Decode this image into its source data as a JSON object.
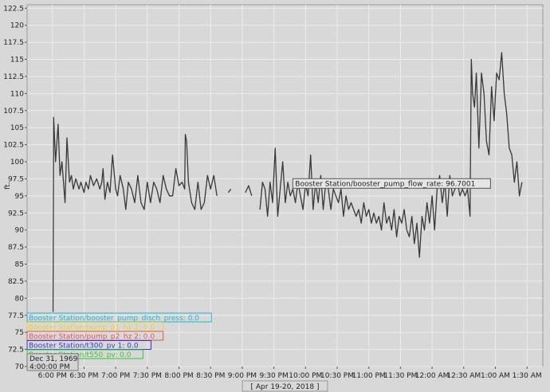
{
  "chart_data": {
    "type": "line",
    "ylabel": "ft.",
    "xlabel": "[ Apr 19-20, 2018 ]",
    "ylim": [
      70,
      123
    ],
    "xlim_hours": [
      17.6,
      25.75
    ],
    "grid": true,
    "background": "#d8d8d8",
    "y_ticks": [
      "70",
      "72.5",
      "75",
      "77.5",
      "80",
      "82.5",
      "85",
      "87.5",
      "90",
      "92.5",
      "95",
      "97.5",
      "100",
      "102.5",
      "105",
      "107.5",
      "110",
      "112.5",
      "115",
      "117.5",
      "120",
      "122.5"
    ],
    "x_ticks": [
      {
        "label": "6:00 PM",
        "h": 18.0
      },
      {
        "label": "6:30 PM",
        "h": 18.5
      },
      {
        "label": "7:00 PM",
        "h": 19.0
      },
      {
        "label": "7:30 PM",
        "h": 19.5
      },
      {
        "label": "8:00 PM",
        "h": 20.0
      },
      {
        "label": "8:30 PM",
        "h": 20.5
      },
      {
        "label": "9:00 PM",
        "h": 21.0
      },
      {
        "label": "9:30 PM",
        "h": 21.5
      },
      {
        "label": "10:00 PM",
        "h": 22.0
      },
      {
        "label": "10:30 PM",
        "h": 22.5
      },
      {
        "label": "11:00 PM",
        "h": 23.0
      },
      {
        "label": "11:30 PM",
        "h": 23.5
      },
      {
        "label": "12:00 AM",
        "h": 24.0
      },
      {
        "label": "12:30 AM",
        "h": 24.5
      },
      {
        "label": "1:00 AM",
        "h": 25.0
      },
      {
        "label": "1:30 AM",
        "h": 25.5
      }
    ],
    "tooltip": {
      "text": "Booster Station/booster_pump_flow_rate: 96.7001",
      "h": 22.0,
      "y": 96.7
    },
    "legend": [
      {
        "text": "Booster Station/booster_pump_disch_press: 0.0",
        "color": "#22b8c8"
      },
      {
        "text": "Booster Station/pump_p1_hz 2: 0.0",
        "color": "#e8d040"
      },
      {
        "text": "Booster Station/pump_p2_hz 2: 0.0",
        "color": "#e05858"
      },
      {
        "text": "Booster Station/t300_pv 1: 0.0",
        "color": "#3838d8"
      },
      {
        "text": "Booster Station/t550_pv: 0.0",
        "color": "#38c838"
      }
    ],
    "cursor_label": {
      "date": "Dec 31, 1969",
      "time": "4:00:00 PM"
    },
    "series": [
      {
        "name": "Booster Station/booster_pump_flow_rate",
        "color": "#383838",
        "segments": [
          [
            [
              18.01,
              78
            ],
            [
              18.02,
              106.5
            ],
            [
              18.05,
              100
            ],
            [
              18.09,
              105.5
            ],
            [
              18.12,
              98
            ],
            [
              18.15,
              100
            ],
            [
              18.2,
              94
            ],
            [
              18.23,
              103.5
            ],
            [
              18.27,
              97
            ],
            [
              18.3,
              98
            ],
            [
              18.33,
              96
            ],
            [
              18.37,
              97.5
            ],
            [
              18.42,
              96
            ],
            [
              18.45,
              97
            ],
            [
              18.5,
              95.5
            ],
            [
              18.53,
              97
            ],
            [
              18.57,
              96
            ],
            [
              18.6,
              98
            ],
            [
              18.65,
              96.5
            ],
            [
              18.7,
              97.5
            ],
            [
              18.75,
              96
            ],
            [
              18.78,
              97
            ],
            [
              18.8,
              99
            ],
            [
              18.83,
              94.5
            ],
            [
              18.87,
              97
            ],
            [
              18.91,
              95.5
            ],
            [
              18.95,
              101
            ],
            [
              19.0,
              96
            ],
            [
              19.03,
              95
            ],
            [
              19.07,
              98
            ],
            [
              19.12,
              96
            ],
            [
              19.16,
              93
            ],
            [
              19.2,
              97
            ],
            [
              19.25,
              96
            ],
            [
              19.3,
              94
            ],
            [
              19.35,
              98
            ],
            [
              19.4,
              94
            ],
            [
              19.45,
              93
            ],
            [
              19.5,
              97
            ],
            [
              19.55,
              94
            ],
            [
              19.6,
              97
            ],
            [
              19.65,
              96
            ],
            [
              19.7,
              94
            ],
            [
              19.75,
              98
            ],
            [
              19.8,
              96
            ],
            [
              19.85,
              95
            ],
            [
              19.9,
              95
            ],
            [
              19.95,
              99
            ],
            [
              20.0,
              96.5
            ],
            [
              20.05,
              97
            ],
            [
              20.09,
              96
            ],
            [
              20.1,
              104
            ],
            [
              20.12,
              103
            ],
            [
              20.15,
              97
            ],
            [
              20.2,
              94
            ],
            [
              20.25,
              93
            ],
            [
              20.3,
              97
            ],
            [
              20.35,
              93
            ],
            [
              20.4,
              94
            ],
            [
              20.45,
              98
            ],
            [
              20.5,
              96
            ],
            [
              20.55,
              98
            ],
            [
              20.6,
              95
            ]
          ],
          [
            [
              20.78,
              95.5
            ],
            [
              20.82,
              96
            ]
          ],
          [
            [
              21.05,
              95.5
            ],
            [
              21.1,
              96.5
            ],
            [
              21.15,
              95
            ]
          ],
          [
            [
              21.28,
              93
            ],
            [
              21.32,
              97
            ],
            [
              21.36,
              96
            ],
            [
              21.4,
              92
            ],
            [
              21.44,
              97
            ],
            [
              21.48,
              94
            ],
            [
              21.52,
              102
            ],
            [
              21.56,
              92
            ],
            [
              21.6,
              96
            ],
            [
              21.64,
              100
            ],
            [
              21.68,
              94
            ],
            [
              21.72,
              97
            ],
            [
              21.76,
              95
            ],
            [
              21.8,
              96
            ],
            [
              21.84,
              94
            ],
            [
              21.88,
              97
            ],
            [
              21.92,
              95
            ],
            [
              21.96,
              93
            ],
            [
              22.0,
              96.7
            ],
            [
              22.04,
              95
            ],
            [
              22.08,
              101
            ],
            [
              22.12,
              93
            ],
            [
              22.16,
              97
            ],
            [
              22.2,
              94
            ],
            [
              22.24,
              98
            ],
            [
              22.28,
              93
            ],
            [
              22.32,
              97
            ],
            [
              22.36,
              96
            ],
            [
              22.4,
              93
            ],
            [
              22.44,
              96
            ],
            [
              22.48,
              95
            ],
            [
              22.52,
              94
            ],
            [
              22.56,
              96
            ],
            [
              22.6,
              92
            ],
            [
              22.64,
              95
            ],
            [
              22.68,
              93
            ],
            [
              22.72,
              94
            ],
            [
              22.76,
              93
            ],
            [
              22.8,
              92
            ],
            [
              22.84,
              93
            ],
            [
              22.88,
              91
            ],
            [
              22.92,
              94
            ],
            [
              22.96,
              92
            ],
            [
              23.0,
              93
            ],
            [
              23.04,
              91
            ],
            [
              23.08,
              92.5
            ],
            [
              23.12,
              91
            ],
            [
              23.16,
              92
            ],
            [
              23.2,
              90
            ],
            [
              23.24,
              94
            ],
            [
              23.28,
              91
            ],
            [
              23.32,
              92
            ],
            [
              23.36,
              90
            ],
            [
              23.4,
              93
            ],
            [
              23.44,
              89
            ],
            [
              23.48,
              92
            ],
            [
              23.52,
              91
            ],
            [
              23.56,
              93
            ],
            [
              23.6,
              90
            ],
            [
              23.64,
              89
            ],
            [
              23.68,
              92
            ],
            [
              23.72,
              88
            ],
            [
              23.76,
              91
            ],
            [
              23.8,
              86
            ],
            [
              23.84,
              92
            ],
            [
              23.88,
              90
            ],
            [
              23.92,
              94
            ],
            [
              23.96,
              91
            ],
            [
              24.0,
              95
            ],
            [
              24.04,
              90
            ],
            [
              24.08,
              96
            ],
            [
              24.12,
              98
            ],
            [
              24.16,
              94
            ],
            [
              24.2,
              97
            ],
            [
              24.24,
              92
            ],
            [
              24.28,
              98
            ],
            [
              24.32,
              95
            ],
            [
              24.36,
              96
            ],
            [
              24.4,
              97
            ],
            [
              24.44,
              95
            ],
            [
              24.48,
              96
            ],
            [
              24.52,
              95
            ],
            [
              24.56,
              96
            ],
            [
              24.6,
              92
            ],
            [
              24.62,
              115
            ],
            [
              24.64,
              110
            ],
            [
              24.67,
              108
            ],
            [
              24.7,
              113
            ],
            [
              24.74,
              102
            ],
            [
              24.78,
              113
            ],
            [
              24.82,
              110
            ],
            [
              24.86,
              103
            ],
            [
              24.9,
              101
            ],
            [
              24.94,
              111
            ],
            [
              24.98,
              106
            ],
            [
              25.02,
              113
            ],
            [
              25.06,
              112
            ],
            [
              25.1,
              116
            ],
            [
              25.14,
              110
            ],
            [
              25.18,
              107
            ],
            [
              25.22,
              102
            ],
            [
              25.26,
              101
            ],
            [
              25.3,
              97
            ],
            [
              25.34,
              100
            ],
            [
              25.38,
              95
            ],
            [
              25.42,
              97
            ]
          ]
        ]
      }
    ]
  }
}
